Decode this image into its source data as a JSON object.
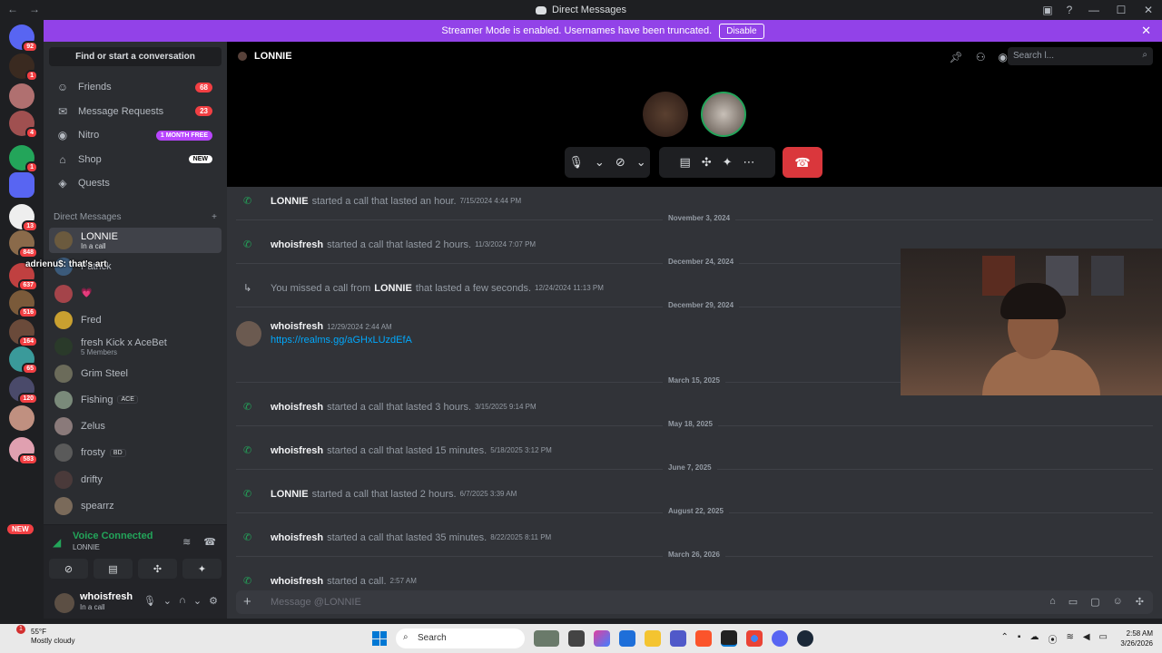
{
  "titlebar": {
    "title": "Direct Messages"
  },
  "banner": {
    "text": "Streamer Mode is enabled. Usernames have been truncated.",
    "button": "Disable"
  },
  "servers": {
    "badges": [
      "92",
      "1",
      "4",
      "1",
      "13",
      "848",
      "637",
      "516",
      "164",
      "65",
      "120",
      "583"
    ],
    "new_label": "NEW"
  },
  "overlay_text": "adrienu$: that's art",
  "sidebar": {
    "find": "Find or start a conversation",
    "nav": [
      {
        "label": "Friends",
        "count": "68"
      },
      {
        "label": "Message Requests",
        "count": "23"
      },
      {
        "label": "Nitro",
        "pill": "1 MONTH FREE"
      },
      {
        "label": "Shop",
        "pill": "NEW"
      },
      {
        "label": "Quests"
      }
    ],
    "dm_header": "Direct Messages",
    "dms": [
      {
        "name": "LONNIE",
        "sub": "In a call",
        "color": "#6b5a3e"
      },
      {
        "name": "Patrick",
        "sub": "",
        "color": "#3b5a7a"
      },
      {
        "name": "",
        "sub": "",
        "emoji": "💗",
        "color": "#a4444a"
      },
      {
        "name": "Fred",
        "sub": "",
        "color": "#c9a030"
      },
      {
        "name": "fresh Kick x AceBet",
        "sub": "5 Members",
        "color": "#2a3a2a"
      },
      {
        "name": "Grim Steel",
        "sub": "",
        "color": "#6b6b5a"
      },
      {
        "name": "Fishing",
        "sub": "",
        "tag": "ACE",
        "color": "#7a8a7a"
      },
      {
        "name": "Zelus",
        "sub": "",
        "color": "#8a7a7a"
      },
      {
        "name": "frosty",
        "sub": "",
        "tag": "BD",
        "color": "#5a5a5a"
      },
      {
        "name": "drifty",
        "sub": "",
        "color": "#4a3a3a"
      },
      {
        "name": "spearrz",
        "sub": "",
        "color": "#7a6a5a"
      }
    ],
    "voice": {
      "title": "Voice Connected",
      "sub": "LONNIE"
    },
    "user": {
      "name": "whoisfresh",
      "status": "In a call"
    }
  },
  "call": {
    "header": "LONNIE",
    "search_placeholder": "Search l..."
  },
  "messages": [
    {
      "type": "call",
      "user": "LONNIE",
      "text": "started a call that lasted an hour.",
      "ts": "7/15/2024 4:44 PM"
    },
    {
      "type": "divider",
      "text": "November 3, 2024"
    },
    {
      "type": "call",
      "user": "whoisfresh",
      "text": "started a call that lasted 2 hours.",
      "ts": "11/3/2024 7:07 PM"
    },
    {
      "type": "divider",
      "text": "December 24, 2024"
    },
    {
      "type": "missed",
      "pre": "You missed a call from",
      "user": "LONNIE",
      "text": "that lasted a few seconds.",
      "ts": "12/24/2024 11:13 PM"
    },
    {
      "type": "divider",
      "text": "December 29, 2024"
    },
    {
      "type": "message",
      "user": "whoisfresh",
      "ts": "12/29/2024 2:44 AM",
      "link": "https://realms.gg/aGHxLUzdEfA"
    },
    {
      "type": "divider",
      "text": "March 15, 2025"
    },
    {
      "type": "call",
      "user": "whoisfresh",
      "text": "started a call that lasted 3 hours.",
      "ts": "3/15/2025 9:14 PM"
    },
    {
      "type": "divider",
      "text": "May 18, 2025"
    },
    {
      "type": "call",
      "user": "whoisfresh",
      "text": "started a call that lasted 15 minutes.",
      "ts": "5/18/2025 3:12 PM"
    },
    {
      "type": "divider",
      "text": "June 7, 2025"
    },
    {
      "type": "call",
      "user": "LONNIE",
      "text": "started a call that lasted 2 hours.",
      "ts": "6/7/2025 3:39 AM"
    },
    {
      "type": "divider",
      "text": "August 22, 2025"
    },
    {
      "type": "call",
      "user": "whoisfresh",
      "text": "started a call that lasted 35 minutes.",
      "ts": "8/22/2025 8:11 PM"
    },
    {
      "type": "divider",
      "text": "March 26, 2026"
    },
    {
      "type": "call",
      "user": "whoisfresh",
      "text": "started a call.",
      "ts": "2:57 AM"
    }
  ],
  "composer": {
    "placeholder": "Message @LONNIE"
  },
  "taskbar": {
    "weather_temp": "55°F",
    "weather_desc": "Mostly cloudy",
    "weather_badge": "1",
    "search": "Search",
    "time": "2:58 AM",
    "date": "3/26/2026"
  }
}
